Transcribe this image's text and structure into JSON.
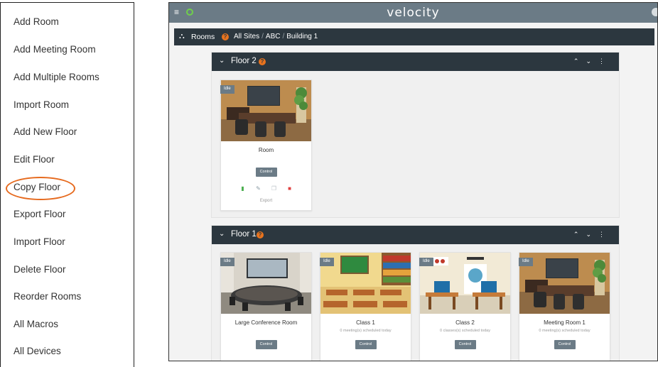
{
  "menu": {
    "items": [
      {
        "label": "Add Room"
      },
      {
        "label": "Add Meeting Room"
      },
      {
        "label": "Add Multiple Rooms"
      },
      {
        "label": "Import Room"
      },
      {
        "label": "Add New Floor"
      },
      {
        "label": "Edit Floor"
      },
      {
        "label": "Copy Floor"
      },
      {
        "label": "Export Floor"
      },
      {
        "label": "Import Floor"
      },
      {
        "label": "Delete Floor"
      },
      {
        "label": "Reorder Rooms"
      },
      {
        "label": "All Macros"
      },
      {
        "label": "All Devices"
      }
    ],
    "highlighted": "Copy Floor",
    "highlight_color": "#e66a1e"
  },
  "app": {
    "logo": "velocity",
    "topbar_color": "#6b7b86",
    "breadcrumb": {
      "section": "Rooms",
      "path": [
        "All Sites",
        "ABC",
        "Building 1"
      ]
    }
  },
  "floors": [
    {
      "name": "Floor 2",
      "rooms": [
        {
          "status": "Idle",
          "name": "Room",
          "subtitle": "",
          "control": "Control",
          "export": "Export",
          "image": "office"
        }
      ]
    },
    {
      "name": "Floor 1",
      "rooms": [
        {
          "status": "Idle",
          "name": "Large Conference Room",
          "subtitle": "",
          "control": "Control",
          "image": "conference"
        },
        {
          "status": "Idle",
          "name": "Class 1",
          "subtitle": "0 meeting(s) scheduled today",
          "control": "Control",
          "image": "classroom"
        },
        {
          "status": "Idle",
          "name": "Class 2",
          "subtitle": "0 classes(s) scheduled today",
          "control": "Control",
          "image": "lab"
        },
        {
          "status": "Idle",
          "name": "Meeting Room 1",
          "subtitle": "0 meeting(s) scheduled today",
          "control": "Control",
          "image": "office"
        }
      ]
    }
  ],
  "icons": {
    "floor_chevron": "chevron-down-icon",
    "floor_controls": [
      "chevron-up-icon",
      "chevron-down-icon",
      "more-vertical-icon"
    ],
    "card_actions": [
      "power-icon",
      "edit-icon",
      "copy-icon",
      "delete-icon"
    ]
  }
}
